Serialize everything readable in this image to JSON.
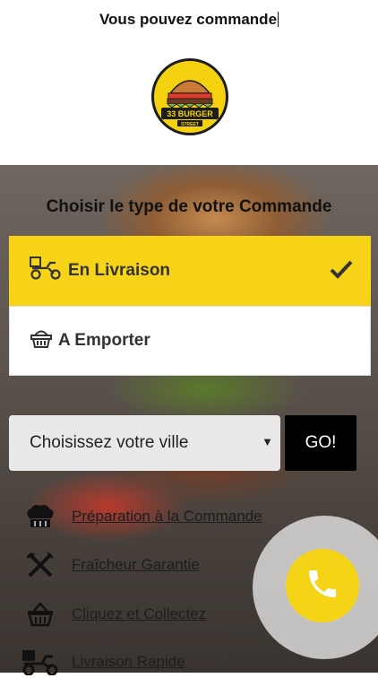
{
  "header": {
    "typing_text": "Vous pouvez commande"
  },
  "logo": {
    "line1": "33 BURGER",
    "line2": "STREET"
  },
  "order": {
    "heading": "Choisir le type de votre Commande",
    "options": [
      {
        "label": "En Livraison",
        "icon": "delivery-scooter-icon",
        "selected": true
      },
      {
        "label": "A Emporter",
        "icon": "basket-icon",
        "selected": false
      }
    ]
  },
  "city": {
    "selected": "Choisissez votre ville",
    "go_label": "GO!"
  },
  "features": [
    {
      "label": "Préparation à la Commande",
      "icon": "chef-hat-icon"
    },
    {
      "label": "Fraîcheur Garantie",
      "icon": "fork-knife-icon"
    },
    {
      "label": "Cliquez et Collectez",
      "icon": "basket-icon"
    },
    {
      "label": "Livraison Rapide",
      "icon": "delivery-scooter-icon"
    }
  ],
  "colors": {
    "accent": "#f7d417",
    "dark": "#000000"
  }
}
